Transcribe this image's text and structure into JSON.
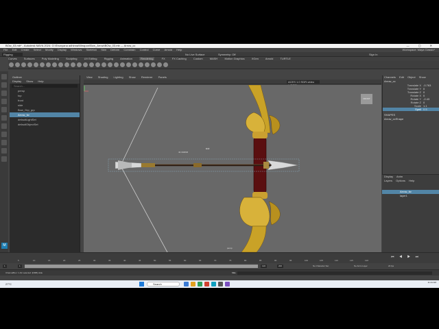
{
  "window": {
    "title": "BOw_03.mb* - Autodesk MAYA 2024: G:\\Shunyana adhinna\\Weapon\\Bow_Arrow\\BOw_03.mb  ---  Arrow_cc",
    "controls": "—  ▢  ✕"
  },
  "menubar": {
    "items": [
      "File",
      "Edit",
      "Create",
      "Select",
      "Modify",
      "Display",
      "Windows",
      "Skeleton",
      "Skin",
      "Deform",
      "Constrain",
      "Control",
      "Curve",
      "Arnold",
      "Help"
    ],
    "workspace": "Workspace: Maya Classic*"
  },
  "statusline": {
    "mode": "Rigging",
    "live_surface": "No Live Surface",
    "symmetry": "Symmetry: Off",
    "sign_in": "Sign In"
  },
  "shelf": {
    "tabs": [
      "Curves",
      "Surfaces",
      "Poly Modeling",
      "Sculpting",
      "UV Editing",
      "Rigging",
      "Animation",
      "Rendering",
      "FX",
      "FX Caching",
      "Custom",
      "MASH",
      "Motion Graphics",
      "XGen",
      "Arnold",
      "TURTLE"
    ]
  },
  "outliner": {
    "title": "Outliner",
    "menu": [
      "Display",
      "Show",
      "Help"
    ],
    "search_placeholder": "Search...",
    "items": [
      "persp",
      "top",
      "front",
      "side",
      "Bow_Grp_grp",
      "Arrow_fw",
      "defaultLightSet",
      "defaultObjectSet"
    ]
  },
  "viewport": {
    "menu": [
      "View",
      "Shading",
      "Lighting",
      "Show",
      "Renderer",
      "Panels"
    ],
    "color_space": "ACES 1.0 SDR-video (sRGB)",
    "view_cube_label": "FRONT",
    "dimension_label": "40.304846",
    "camera_label": "persp",
    "colors": {
      "background": "#686868",
      "bow_gold": "#c9a227",
      "grip": "#5a0f10",
      "string": "#cfcfcf"
    }
  },
  "channelbox": {
    "menu": [
      "Channels",
      "Edit",
      "Object",
      "Show"
    ],
    "object": "Arrow_cc",
    "attributes": [
      {
        "name": "Translate X",
        "value": "-0.763"
      },
      {
        "name": "Translate Y",
        "value": "0"
      },
      {
        "name": "Translate Z",
        "value": "0"
      },
      {
        "name": "Rotate X",
        "value": "0"
      },
      {
        "name": "Rotate Y",
        "value": "-2.43"
      },
      {
        "name": "Rotate Z",
        "value": "0"
      },
      {
        "name": "Scale",
        "value": "1.1"
      },
      {
        "name": "Spell",
        "value": "0.5"
      }
    ],
    "shapes_header": "SHAPES",
    "shape_name": "Arrow_ccShape"
  },
  "layer_editor": {
    "tabs": [
      "Display",
      "Anim"
    ],
    "menu": [
      "Layers",
      "Options",
      "Help"
    ],
    "layers": [
      "Arrow_fw",
      "layer1"
    ]
  },
  "timeline": {
    "ticks": [
      "5",
      "10",
      "15",
      "20",
      "25",
      "30",
      "35",
      "40",
      "45",
      "50",
      "55",
      "60",
      "65",
      "70",
      "75",
      "80",
      "85",
      "90",
      "95",
      "100",
      "105",
      "110",
      "115",
      "120"
    ],
    "playback": "⏮ ◀ ▶ ⏭",
    "start": "1",
    "range_start": "1",
    "range_end": "120",
    "end": "200",
    "character_set": "No Character Set",
    "anim_layer": "No Anim Layer",
    "fps": "24 fps"
  },
  "commandline": {
    "message": "ChannelBox: 1 Attr selected: [RMB] slide",
    "lang": "MEL"
  },
  "taskbar": {
    "weather": "27°C",
    "search": "Search",
    "time": "11:24 AM"
  }
}
